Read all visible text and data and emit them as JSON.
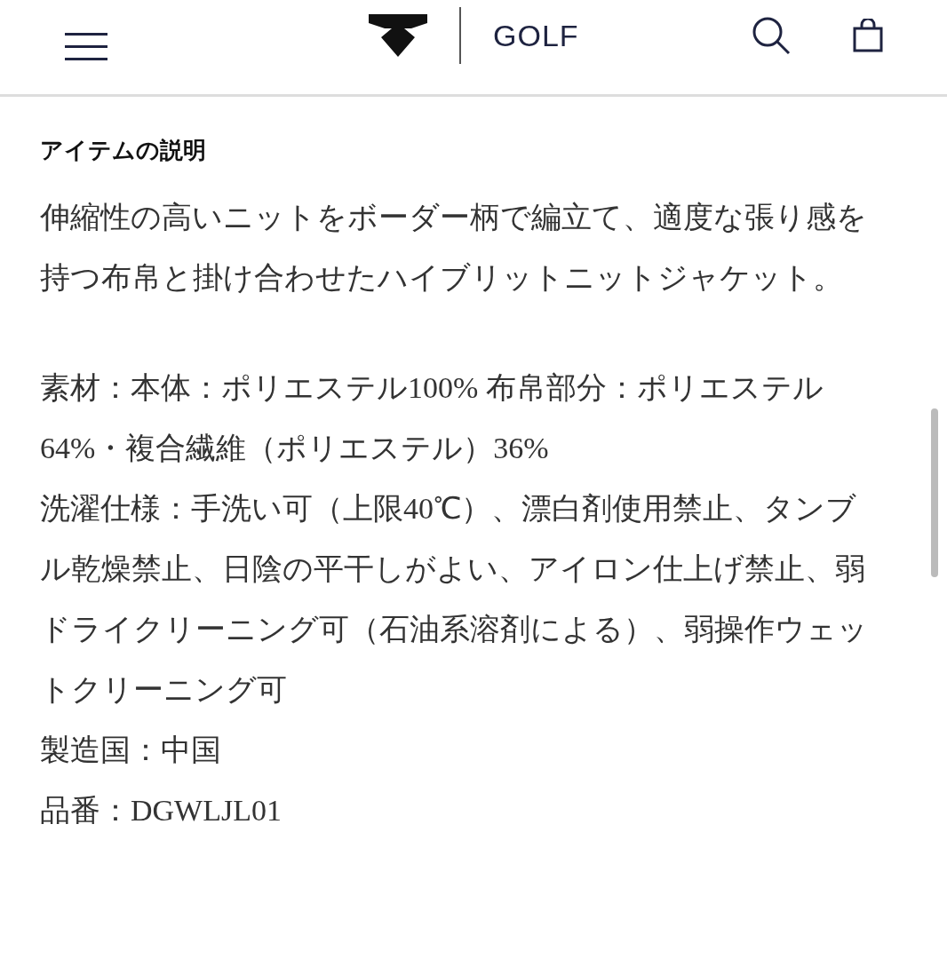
{
  "header": {
    "brand": "GOLF"
  },
  "section": {
    "title": "アイテムの説明",
    "description": "伸縮性の高いニットをボーダー柄で編立て、適度な張り感を持つ布帛と掛け合わせたハイブリットニットジャケット。",
    "details": [
      "素材：本体：ポリエステル100% 布帛部分：ポリエステル64%・複合繊維（ポリエステル）36%",
      "洗濯仕様：手洗い可（上限40℃）、漂白剤使用禁止、タンブル乾燥禁止、日陰の平干しがよい、アイロン仕上げ禁止、弱ドライクリーニング可（石油系溶剤による）、弱操作ウェットクリーニング可",
      "製造国：中国",
      "品番：DGWLJL01"
    ]
  }
}
